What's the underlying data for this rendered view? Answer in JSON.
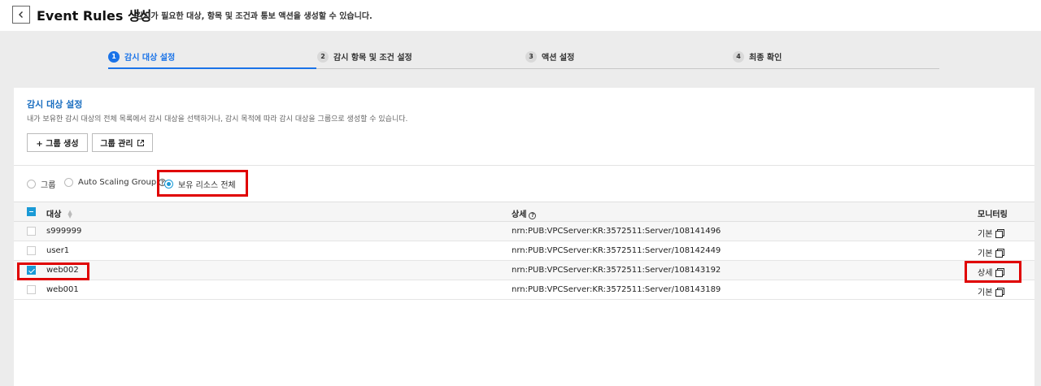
{
  "header": {
    "title": "Event Rules 생성",
    "description": "감시가 필요한 대상, 항목 및 조건과 통보 액션을 생성할 수 있습니다."
  },
  "steps": [
    {
      "num": "1",
      "label": "감시 대상 설정",
      "active": true
    },
    {
      "num": "2",
      "label": "감시 항목 및 조건 설정",
      "active": false
    },
    {
      "num": "3",
      "label": "액션 설정",
      "active": false
    },
    {
      "num": "4",
      "label": "최종 확인",
      "active": false
    }
  ],
  "section": {
    "title": "감시 대상 설정",
    "description": "내가 보유한 감시 대상의 전체 목록에서 감시 대상을 선택하거나, 감시 목적에 따라 감시 대상을 그룹으로 생성할 수 있습니다.",
    "create_group_label": "+ 그룹 생성",
    "manage_group_label": "그룹 관리"
  },
  "radios": {
    "group": "그룹",
    "autoscaling": "Auto Scaling Group",
    "all_resources": "보유 리소스 전체",
    "selected": "all_resources"
  },
  "table": {
    "columns": {
      "target": "대상",
      "detail": "상세",
      "monitoring": "모니터링"
    },
    "rows": [
      {
        "target": "s999999",
        "detail": "nrn:PUB:VPCServer:KR:3572511:Server/108141496",
        "monitoring": "기본",
        "checked": false
      },
      {
        "target": "user1",
        "detail": "nrn:PUB:VPCServer:KR:3572511:Server/108142449",
        "monitoring": "기본",
        "checked": false
      },
      {
        "target": "web002",
        "detail": "nrn:PUB:VPCServer:KR:3572511:Server/108143192",
        "monitoring": "상세",
        "checked": true
      },
      {
        "target": "web001",
        "detail": "nrn:PUB:VPCServer:KR:3572511:Server/108143189",
        "monitoring": "기본",
        "checked": false
      }
    ]
  },
  "colors": {
    "accent": "#1a73e8",
    "checkbox": "#1a9ad6",
    "highlight": "#e00000"
  }
}
